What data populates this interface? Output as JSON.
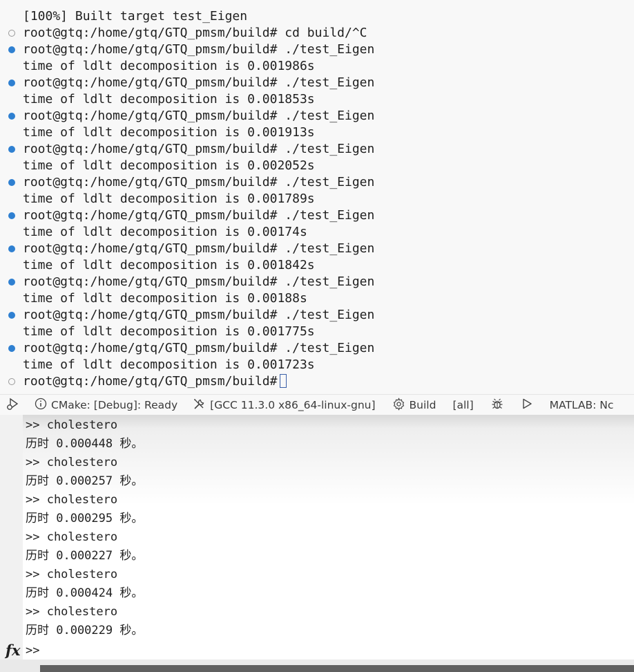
{
  "terminal": {
    "lines": [
      {
        "text": "[100%] Built target test_Eigen",
        "deco": "none"
      },
      {
        "text": "root@gtq:/home/gtq/GTQ_pmsm/build# cd build/^C",
        "deco": "neutral"
      },
      {
        "text": "root@gtq:/home/gtq/GTQ_pmsm/build# ./test_Eigen",
        "deco": "success"
      },
      {
        "text": "time of ldlt decomposition is 0.001986s",
        "deco": "none"
      },
      {
        "text": "root@gtq:/home/gtq/GTQ_pmsm/build# ./test_Eigen",
        "deco": "success"
      },
      {
        "text": "time of ldlt decomposition is 0.001853s",
        "deco": "none"
      },
      {
        "text": "root@gtq:/home/gtq/GTQ_pmsm/build# ./test_Eigen",
        "deco": "success"
      },
      {
        "text": "time of ldlt decomposition is 0.001913s",
        "deco": "none"
      },
      {
        "text": "root@gtq:/home/gtq/GTQ_pmsm/build# ./test_Eigen",
        "deco": "success"
      },
      {
        "text": "time of ldlt decomposition is 0.002052s",
        "deco": "none"
      },
      {
        "text": "root@gtq:/home/gtq/GTQ_pmsm/build# ./test_Eigen",
        "deco": "success"
      },
      {
        "text": "time of ldlt decomposition is 0.001789s",
        "deco": "none"
      },
      {
        "text": "root@gtq:/home/gtq/GTQ_pmsm/build# ./test_Eigen",
        "deco": "success"
      },
      {
        "text": "time of ldlt decomposition is 0.00174s",
        "deco": "none"
      },
      {
        "text": "root@gtq:/home/gtq/GTQ_pmsm/build# ./test_Eigen",
        "deco": "success"
      },
      {
        "text": "time of ldlt decomposition is 0.001842s",
        "deco": "none"
      },
      {
        "text": "root@gtq:/home/gtq/GTQ_pmsm/build# ./test_Eigen",
        "deco": "success"
      },
      {
        "text": "time of ldlt decomposition is 0.00188s",
        "deco": "none"
      },
      {
        "text": "root@gtq:/home/gtq/GTQ_pmsm/build# ./test_Eigen",
        "deco": "success"
      },
      {
        "text": "time of ldlt decomposition is 0.001775s",
        "deco": "none"
      },
      {
        "text": "root@gtq:/home/gtq/GTQ_pmsm/build# ./test_Eigen",
        "deco": "success"
      },
      {
        "text": "time of ldlt decomposition is 0.001723s",
        "deco": "none"
      }
    ],
    "current_prompt": "root@gtq:/home/gtq/GTQ_pmsm/build#",
    "current_prompt_deco": "neutral"
  },
  "statusbar": {
    "cmake_status": "CMake: [Debug]: Ready",
    "kit": "[GCC 11.3.0 x86_64-linux-gnu]",
    "build_label": "Build",
    "build_target": "[all]",
    "matlab_label": "MATLAB: Nc",
    "icons": {
      "run_debug": "run-debug-icon",
      "info": "info-circle-icon",
      "tools": "wrench-screwdriver-icon",
      "build": "gear-icon",
      "debug": "bug-icon",
      "run": "play-icon"
    }
  },
  "matlab": {
    "lines": [
      ">> cholestero",
      "历时 0.000448 秒。",
      ">> cholestero",
      "历时 0.000257 秒。",
      ">> cholestero",
      "历时 0.000295 秒。",
      ">> cholestero",
      "历时 0.000227 秒。",
      ">> cholestero",
      "历时 0.000424 秒。",
      ">> cholestero",
      "历时 0.000229 秒。"
    ],
    "fx_label": "fx",
    "prompt": ">>"
  },
  "colors": {
    "terminal_bg": "#f8f8f8",
    "success_deco": "#2f80d1",
    "neutral_deco": "#9a9a9a",
    "scrollbar": "#5f5f5f"
  }
}
